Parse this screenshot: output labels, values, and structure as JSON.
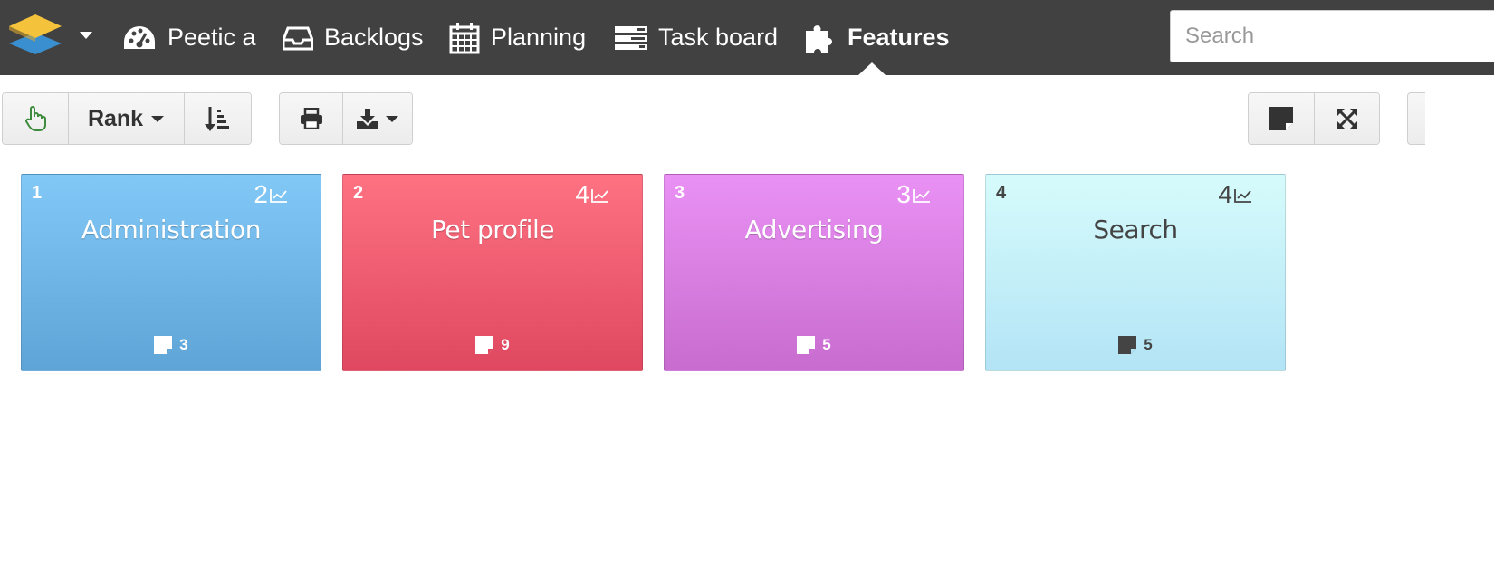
{
  "navbar": {
    "project_label": "Peetic a",
    "items": [
      {
        "label": "Backlogs",
        "icon": "inbox-icon"
      },
      {
        "label": "Planning",
        "icon": "calendar-icon"
      },
      {
        "label": "Task board",
        "icon": "tasks-icon"
      },
      {
        "label": "Features",
        "icon": "puzzle-icon",
        "active": true
      }
    ],
    "search_placeholder": "Search",
    "colors": {
      "background": "#414141",
      "text": "#ffffff"
    }
  },
  "toolbar": {
    "rank_label": "Rank",
    "buttons": [
      "hand-pointer-icon",
      "sort-icon",
      "print-icon",
      "download-icon",
      "sticky-note-icon",
      "expand-icon"
    ]
  },
  "features": [
    {
      "rank": "1",
      "points": "2",
      "title": "Administration",
      "stories": "3",
      "color_top": "#82c8f7",
      "color_bottom": "#5ea4d6",
      "text_color": "#ffffff"
    },
    {
      "rank": "2",
      "points": "4",
      "title": "Pet profile",
      "stories": "9",
      "color_top": "#fe7282",
      "color_bottom": "#df4860",
      "text_color": "#ffffff"
    },
    {
      "rank": "3",
      "points": "3",
      "title": "Advertising",
      "stories": "5",
      "color_top": "#ea91f5",
      "color_bottom": "#c86ccf",
      "text_color": "#ffffff"
    },
    {
      "rank": "4",
      "points": "4",
      "title": "Search",
      "stories": "5",
      "color_top": "#d6fbfb",
      "color_bottom": "#b3e4f6",
      "text_color": "#444444"
    }
  ]
}
